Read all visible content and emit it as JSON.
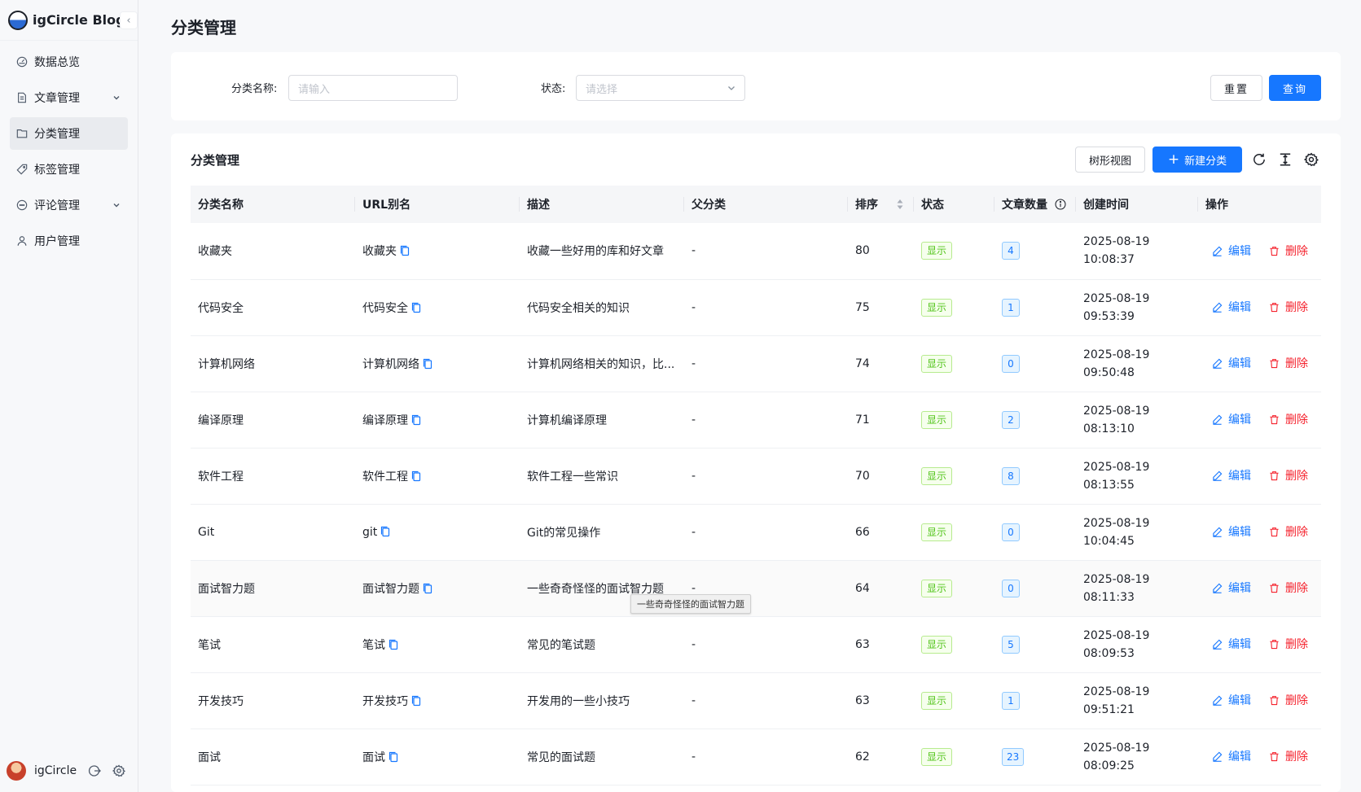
{
  "brand": {
    "title": "igCircle Blog"
  },
  "sidebar": {
    "items": [
      {
        "label": "数据总览",
        "icon": "dashboard-icon",
        "expandable": false,
        "active": false
      },
      {
        "label": "文章管理",
        "icon": "file-icon",
        "expandable": true,
        "active": false
      },
      {
        "label": "分类管理",
        "icon": "folder-icon",
        "expandable": false,
        "active": true
      },
      {
        "label": "标签管理",
        "icon": "tag-icon",
        "expandable": false,
        "active": false
      },
      {
        "label": "评论管理",
        "icon": "comment-icon",
        "expandable": true,
        "active": false
      },
      {
        "label": "用户管理",
        "icon": "user-icon",
        "expandable": false,
        "active": false
      }
    ]
  },
  "user": {
    "name": "igCircle"
  },
  "page": {
    "title": "分类管理"
  },
  "filter": {
    "name_label": "分类名称:",
    "name_placeholder": "请输入",
    "status_label": "状态:",
    "status_placeholder": "请选择",
    "reset_label": "重置",
    "search_label": "查询"
  },
  "table": {
    "title": "分类管理",
    "tree_view_label": "树形视图",
    "new_label": "新建分类",
    "columns": [
      "分类名称",
      "URL别名",
      "描述",
      "父分类",
      "排序",
      "状态",
      "文章数量",
      "创建时间",
      "操作"
    ],
    "edit_label": "编辑",
    "delete_label": "删除",
    "rows": [
      {
        "name": "收藏夹",
        "slug": "收藏夹",
        "desc": "收藏一些好用的库和好文章",
        "parent": "-",
        "sort": "80",
        "status": "显示",
        "count": "4",
        "date": "2025-08-19",
        "time": "10:08:37"
      },
      {
        "name": "代码安全",
        "slug": "代码安全",
        "desc": "代码安全相关的知识",
        "parent": "-",
        "sort": "75",
        "status": "显示",
        "count": "1",
        "date": "2025-08-19",
        "time": "09:53:39"
      },
      {
        "name": "计算机网络",
        "slug": "计算机网络",
        "desc": "计算机网络相关的知识，比...",
        "parent": "-",
        "sort": "74",
        "status": "显示",
        "count": "0",
        "date": "2025-08-19",
        "time": "09:50:48"
      },
      {
        "name": "编译原理",
        "slug": "编译原理",
        "desc": "计算机编译原理",
        "parent": "-",
        "sort": "71",
        "status": "显示",
        "count": "2",
        "date": "2025-08-19",
        "time": "08:13:10"
      },
      {
        "name": "软件工程",
        "slug": "软件工程",
        "desc": "软件工程一些常识",
        "parent": "-",
        "sort": "70",
        "status": "显示",
        "count": "8",
        "date": "2025-08-19",
        "time": "08:13:55"
      },
      {
        "name": "Git",
        "slug": "git",
        "desc": "Git的常见操作",
        "parent": "-",
        "sort": "66",
        "status": "显示",
        "count": "0",
        "date": "2025-08-19",
        "time": "10:04:45"
      },
      {
        "name": "面试智力题",
        "slug": "面试智力题",
        "desc": "一些奇奇怪怪的面试智力题",
        "parent": "-",
        "sort": "64",
        "status": "显示",
        "count": "0",
        "date": "2025-08-19",
        "time": "08:11:33"
      },
      {
        "name": "笔试",
        "slug": "笔试",
        "desc": "常见的笔试题",
        "parent": "-",
        "sort": "63",
        "status": "显示",
        "count": "5",
        "date": "2025-08-19",
        "time": "08:09:53"
      },
      {
        "name": "开发技巧",
        "slug": "开发技巧",
        "desc": "开发用的一些小技巧",
        "parent": "-",
        "sort": "63",
        "status": "显示",
        "count": "1",
        "date": "2025-08-19",
        "time": "09:51:21"
      },
      {
        "name": "面试",
        "slug": "面试",
        "desc": "常见的面试题",
        "parent": "-",
        "sort": "62",
        "status": "显示",
        "count": "23",
        "date": "2025-08-19",
        "time": "08:09:25"
      }
    ]
  },
  "tooltip": {
    "text": "一些奇奇怪怪的面试智力题"
  },
  "colors": {
    "primary": "#1677ff",
    "danger": "#f5222d",
    "success": "#52c41a"
  }
}
